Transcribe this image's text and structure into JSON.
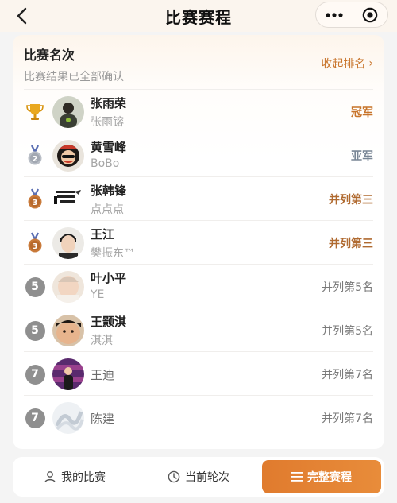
{
  "header": {
    "title": "比赛赛程",
    "back_icon": "chevron-left-icon",
    "more_icon": "more-dots-icon",
    "close_icon": "target-circle-icon"
  },
  "ranking": {
    "title": "比赛名次",
    "subtitle": "比赛结果已全部确认",
    "collapse_label": "收起排名",
    "collapse_icon": "chevron-right-icon",
    "accent_color": "#c8742a",
    "rows": [
      {
        "rank_icon": "trophy-icon",
        "name": "张雨荣",
        "nickname": "张雨镕",
        "result": "冠军"
      },
      {
        "rank_icon": "silver-medal-icon",
        "rank_num": "2",
        "name": "黄雪峰",
        "nickname": "BoBo",
        "result": "亚军"
      },
      {
        "rank_icon": "bronze-medal-icon",
        "rank_num": "3",
        "name": "张韩锋",
        "nickname": "点点点",
        "result": "并列第三"
      },
      {
        "rank_icon": "bronze-medal-icon",
        "rank_num": "3",
        "name": "王江",
        "nickname": "樊振东™",
        "result": "并列第三"
      },
      {
        "rank": "5",
        "name": "叶小平",
        "nickname": "YE",
        "result": "并列第5名"
      },
      {
        "rank": "5",
        "name": "王颢淇",
        "nickname": "淇淇",
        "result": "并列第5名"
      },
      {
        "rank": "7",
        "name": "王迪",
        "result": "并列第7名"
      },
      {
        "rank": "7",
        "name": "陈建",
        "result": "并列第7名"
      }
    ]
  },
  "bottom_nav": {
    "my_matches": {
      "label": "我的比赛",
      "icon": "user-icon"
    },
    "current_round": {
      "label": "当前轮次",
      "icon": "clock-icon"
    },
    "full_schedule": {
      "label": "完整赛程",
      "icon": "list-icon"
    }
  }
}
